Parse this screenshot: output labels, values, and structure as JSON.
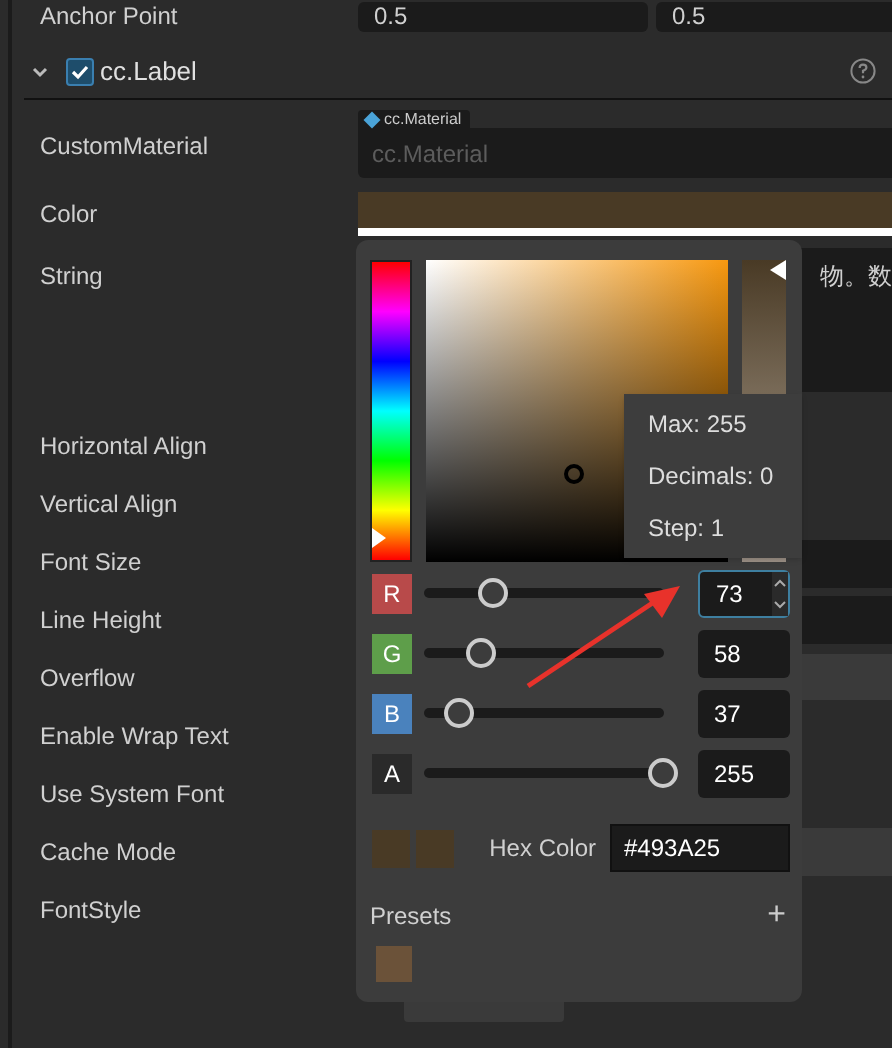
{
  "anchor_point": {
    "label": "Anchor Point",
    "values": [
      "0.5",
      "0.5"
    ]
  },
  "component": {
    "name": "cc.Label",
    "expanded": true,
    "enabled": true
  },
  "properties": [
    {
      "label": "CustomMaterial",
      "kind": "asset",
      "tag": "cc.Material",
      "placeholder": "cc.Material"
    },
    {
      "label": "Color",
      "kind": "color",
      "color": "#493a25"
    },
    {
      "label": "String",
      "kind": "text",
      "value": "物。数"
    },
    {
      "label": "Horizontal Align",
      "kind": "plain"
    },
    {
      "label": "Vertical Align",
      "kind": "plain"
    },
    {
      "label": "Font Size",
      "kind": "plain"
    },
    {
      "label": "Line Height",
      "kind": "plain"
    },
    {
      "label": "Overflow",
      "kind": "plain"
    },
    {
      "label": "Enable Wrap Text",
      "kind": "plain"
    },
    {
      "label": "Use System Font",
      "kind": "plain"
    },
    {
      "label": "Cache Mode",
      "kind": "plain"
    },
    {
      "label": "FontStyle",
      "kind": "plain"
    }
  ],
  "color_picker": {
    "hue": {
      "level": 0.11
    },
    "alpha": {
      "level": 1
    },
    "channels": [
      {
        "name": "R",
        "value": "73",
        "level": 0.29,
        "color": "#b84a4a",
        "focused": true
      },
      {
        "name": "G",
        "value": "58",
        "level": 0.24,
        "color": "#5e9e4a",
        "focused": false
      },
      {
        "name": "B",
        "value": "37",
        "level": 0.15,
        "color": "#4a82bd",
        "focused": false
      },
      {
        "name": "A",
        "value": "255",
        "level": 1,
        "color": "#2a2a2a",
        "focused": false
      }
    ],
    "swatches": [
      {
        "color": "#493a25"
      },
      {
        "color": "#493a25"
      }
    ],
    "hex_label": "Hex Color",
    "hex": "#493A25",
    "presets_label": "Presets",
    "add": "+",
    "presets": [
      {
        "color": "#6b5239"
      }
    ],
    "tooltip": [
      "Max: 255",
      "Decimals: 0",
      "Step: 1"
    ]
  }
}
